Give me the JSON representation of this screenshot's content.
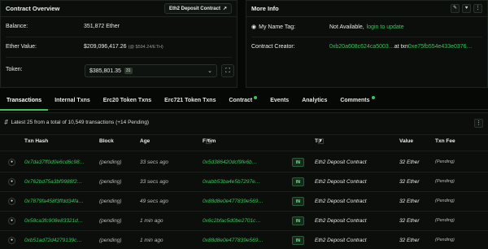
{
  "overview": {
    "title": "Contract Overview",
    "tag_button": "Eth2 Deposit Contract",
    "balance_label": "Balance:",
    "balance_value": "351,872 Ether",
    "ether_value_label": "Ether Value:",
    "ether_value": "$209,096,417.26",
    "ether_value_sub": "(@ $594.24/ETH)",
    "token_label": "Token:",
    "token_value": "$385,801.35",
    "token_count": "31"
  },
  "more_info": {
    "title": "More Info",
    "name_tag_label": "My Name Tag:",
    "name_tag_value": "Not Available, ",
    "name_tag_link": "login to update",
    "creator_label": "Contract Creator:",
    "creator_address": "0xb20a608c624ca5003…",
    "creator_at": " at txn ",
    "creator_txn": "0xe75fb554e433e0376…"
  },
  "tabs": [
    {
      "label": "Transactions"
    },
    {
      "label": "Internal Txns"
    },
    {
      "label": "Erc20 Token Txns"
    },
    {
      "label": "Erc721 Token Txns"
    },
    {
      "label": "Contract"
    },
    {
      "label": "Events"
    },
    {
      "label": "Analytics"
    },
    {
      "label": "Comments"
    }
  ],
  "summary": "Latest 25 from a total of 10,549 transactions (+14 Pending)",
  "columns": {
    "txn_hash": "Txn Hash",
    "block": "Block",
    "age": "Age",
    "from": "From",
    "to": "To",
    "value": "Value",
    "fee": "Txn Fee"
  },
  "rows": [
    {
      "hash": "0x7da37ff0d0e6cd6c98…",
      "block": "(pending)",
      "age": "33 secs ago",
      "from": "0x5d386420dcf9fe6b…",
      "dir": "IN",
      "to": "Eth2 Deposit Contract",
      "value": "32 Ether",
      "fee": "(Pending)"
    },
    {
      "hash": "0x762bd75a3bf9988f2…",
      "block": "(pending)",
      "age": "33 secs ago",
      "from": "0xabb53ba4e5b7297e…",
      "dir": "IN",
      "to": "Eth2 Deposit Contract",
      "value": "32 Ether",
      "fee": "(Pending)"
    },
    {
      "hash": "0x7879fa458f3ffdd34fa…",
      "block": "(pending)",
      "age": "49 secs ago",
      "from": "0x88d8e0e477839e569…",
      "dir": "IN",
      "to": "Eth2 Deposit Contract",
      "value": "32 Ether",
      "fee": "(Pending)"
    },
    {
      "hash": "0x58ca3fc908e83321d…",
      "block": "(pending)",
      "age": "1 min ago",
      "from": "0x6c2bfac5d0be2701c…",
      "dir": "IN",
      "to": "Eth2 Deposit Contract",
      "value": "32 Ether",
      "fee": "(Pending)"
    },
    {
      "hash": "0xb51ad72d4279139c…",
      "block": "(pending)",
      "age": "1 min ago",
      "from": "0x88d8e0e477839e569…",
      "dir": "IN",
      "to": "Eth2 Deposit Contract",
      "value": "32 Ether",
      "fee": "(Pending)"
    }
  ],
  "colors": {
    "accent": "#3ec25e",
    "background": "#050805",
    "card": "#0b0e0b"
  }
}
